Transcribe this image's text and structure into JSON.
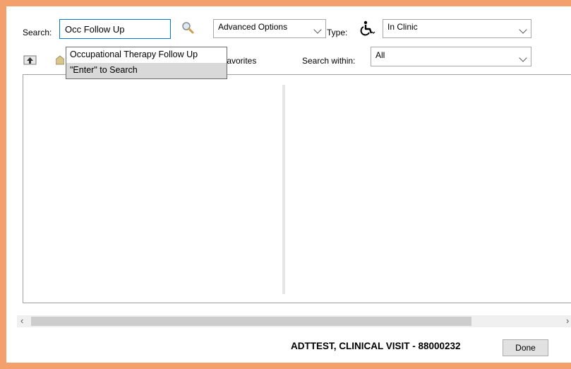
{
  "search": {
    "label": "Search:",
    "value": "Occ Follow Up",
    "suggestions": [
      {
        "label": "Occupational Therapy Follow Up"
      },
      {
        "label": "\"Enter\" to Search"
      }
    ]
  },
  "advanced_options": {
    "value": "Advanced Options"
  },
  "type": {
    "label": "Type:",
    "value": "In Clinic",
    "icon": "wheelchair-icon"
  },
  "toolbar": {
    "favorites_label": "Favorites"
  },
  "search_within": {
    "label": "Search within:",
    "value": "All"
  },
  "footer": {
    "patient_label": "ADTTEST, CLINICAL VISIT - 88000232",
    "done_label": "Done"
  },
  "colors": {
    "frame_border": "#f3a06c",
    "focus_border": "#0078d7",
    "highlight": "#d9d9d9"
  }
}
